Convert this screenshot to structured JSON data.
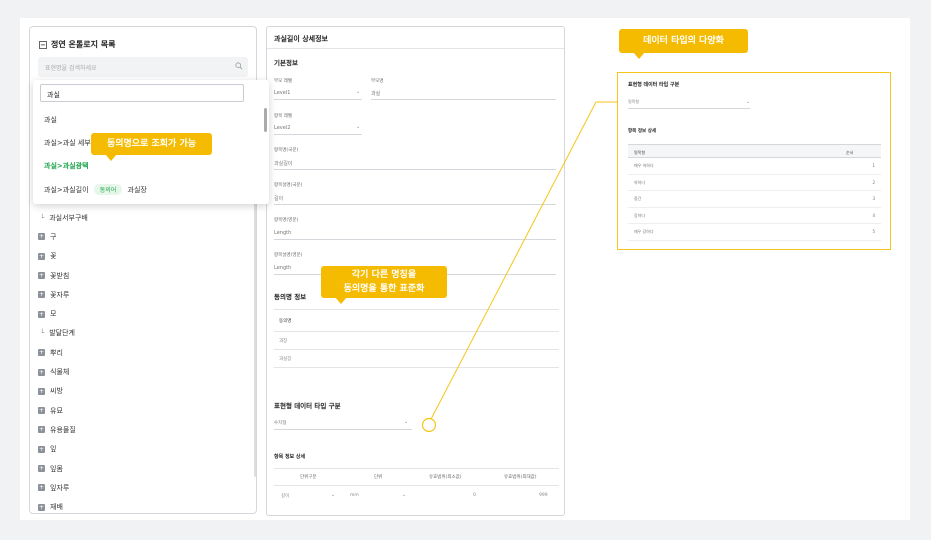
{
  "left_panel": {
    "title": "정연 온톨로지 목록",
    "search_placeholder": "표현명을 검색하세요",
    "tree_items": [
      {
        "label": "과실서부구배",
        "type": "sub"
      },
      {
        "label": "구",
        "type": "node"
      },
      {
        "label": "꽃",
        "type": "node"
      },
      {
        "label": "꽃받침",
        "type": "node"
      },
      {
        "label": "꽃자루",
        "type": "node"
      },
      {
        "label": "모",
        "type": "node"
      },
      {
        "label": "발달단계",
        "type": "sub"
      },
      {
        "label": "뿌리",
        "type": "node"
      },
      {
        "label": "식물체",
        "type": "node"
      },
      {
        "label": "씨방",
        "type": "node"
      },
      {
        "label": "유묘",
        "type": "node"
      },
      {
        "label": "유용물질",
        "type": "node"
      },
      {
        "label": "잎",
        "type": "node"
      },
      {
        "label": "잎몸",
        "type": "node"
      },
      {
        "label": "잎자루",
        "type": "node"
      },
      {
        "label": "재배",
        "type": "node"
      },
      {
        "label": "종자",
        "type": "node"
      }
    ]
  },
  "popup": {
    "input_value": "과실",
    "items": [
      {
        "label": "과실"
      },
      {
        "label": "과실>과실 세부"
      },
      {
        "label": "과실>과실광택"
      },
      {
        "prefix": "과실>과실길이",
        "pill": "동의어",
        "suffix": "과실장"
      }
    ]
  },
  "callouts": {
    "synonym_search": "동의명으로 조회가 가능",
    "standardization_line1": "각기 다른 명칭을",
    "standardization_line2": "동의명을 통한 표준화",
    "data_type_variety": "데이터 타입의 다양화"
  },
  "detail": {
    "title": "과실길이 상세정보",
    "basic_section": "기본정보",
    "fields": {
      "parent_level_label": "부모 레벨",
      "parent_level_value": "Level1",
      "parent_name_label": "부모명",
      "parent_name_value": "과실",
      "item_level_label": "항목 레벨",
      "item_level_value": "Level2",
      "item_name_kr_label": "항목명(국문)",
      "item_name_kr_value": "과실길이",
      "item_desc_kr_label": "항목설명(국문)",
      "item_desc_kr_value": "길이",
      "item_name_en_label": "항목명(영문)",
      "item_name_en_value": "Length",
      "item_desc_en_label": "항목설명(영문)",
      "item_desc_en_value": "Length"
    },
    "synonym_section": "동의명 정보",
    "synonym_header": "동의명",
    "synonyms": [
      "과장",
      "과실장"
    ],
    "datatype_section": "표현형 데이터 타입 구분",
    "datatype_value": "수치형",
    "item_detail_section": "항목 정보 상세",
    "table_headers": [
      "단위구분",
      "단위",
      "유효범위(최소값)",
      "유효범위(최대값)"
    ],
    "table_row": [
      "길이",
      "mm",
      "0",
      "999"
    ]
  },
  "right_panel": {
    "title": "표현형 데이터 타입 구분",
    "select_value": "명목형",
    "section": "항목 정보 상세",
    "header_name": "명목형",
    "header_order": "순서",
    "rows": [
      {
        "name": "매우 약하다",
        "order": "1"
      },
      {
        "name": "약하다",
        "order": "2"
      },
      {
        "name": "중간",
        "order": "3"
      },
      {
        "name": "강하다",
        "order": "4"
      },
      {
        "name": "매우 강하다",
        "order": "5"
      }
    ]
  },
  "colors": {
    "accent": "#f5bb00",
    "synonym_green": "#1ba34a"
  }
}
